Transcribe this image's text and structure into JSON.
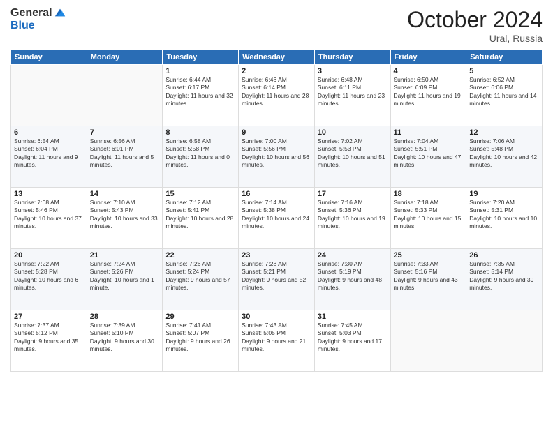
{
  "logo": {
    "general": "General",
    "blue": "Blue"
  },
  "title": "October 2024",
  "location": "Ural, Russia",
  "days_header": [
    "Sunday",
    "Monday",
    "Tuesday",
    "Wednesday",
    "Thursday",
    "Friday",
    "Saturday"
  ],
  "weeks": [
    [
      {
        "day": "",
        "info": ""
      },
      {
        "day": "",
        "info": ""
      },
      {
        "day": "1",
        "info": "Sunrise: 6:44 AM\nSunset: 6:17 PM\nDaylight: 11 hours and 32 minutes."
      },
      {
        "day": "2",
        "info": "Sunrise: 6:46 AM\nSunset: 6:14 PM\nDaylight: 11 hours and 28 minutes."
      },
      {
        "day": "3",
        "info": "Sunrise: 6:48 AM\nSunset: 6:11 PM\nDaylight: 11 hours and 23 minutes."
      },
      {
        "day": "4",
        "info": "Sunrise: 6:50 AM\nSunset: 6:09 PM\nDaylight: 11 hours and 19 minutes."
      },
      {
        "day": "5",
        "info": "Sunrise: 6:52 AM\nSunset: 6:06 PM\nDaylight: 11 hours and 14 minutes."
      }
    ],
    [
      {
        "day": "6",
        "info": "Sunrise: 6:54 AM\nSunset: 6:04 PM\nDaylight: 11 hours and 9 minutes."
      },
      {
        "day": "7",
        "info": "Sunrise: 6:56 AM\nSunset: 6:01 PM\nDaylight: 11 hours and 5 minutes."
      },
      {
        "day": "8",
        "info": "Sunrise: 6:58 AM\nSunset: 5:58 PM\nDaylight: 11 hours and 0 minutes."
      },
      {
        "day": "9",
        "info": "Sunrise: 7:00 AM\nSunset: 5:56 PM\nDaylight: 10 hours and 56 minutes."
      },
      {
        "day": "10",
        "info": "Sunrise: 7:02 AM\nSunset: 5:53 PM\nDaylight: 10 hours and 51 minutes."
      },
      {
        "day": "11",
        "info": "Sunrise: 7:04 AM\nSunset: 5:51 PM\nDaylight: 10 hours and 47 minutes."
      },
      {
        "day": "12",
        "info": "Sunrise: 7:06 AM\nSunset: 5:48 PM\nDaylight: 10 hours and 42 minutes."
      }
    ],
    [
      {
        "day": "13",
        "info": "Sunrise: 7:08 AM\nSunset: 5:46 PM\nDaylight: 10 hours and 37 minutes."
      },
      {
        "day": "14",
        "info": "Sunrise: 7:10 AM\nSunset: 5:43 PM\nDaylight: 10 hours and 33 minutes."
      },
      {
        "day": "15",
        "info": "Sunrise: 7:12 AM\nSunset: 5:41 PM\nDaylight: 10 hours and 28 minutes."
      },
      {
        "day": "16",
        "info": "Sunrise: 7:14 AM\nSunset: 5:38 PM\nDaylight: 10 hours and 24 minutes."
      },
      {
        "day": "17",
        "info": "Sunrise: 7:16 AM\nSunset: 5:36 PM\nDaylight: 10 hours and 19 minutes."
      },
      {
        "day": "18",
        "info": "Sunrise: 7:18 AM\nSunset: 5:33 PM\nDaylight: 10 hours and 15 minutes."
      },
      {
        "day": "19",
        "info": "Sunrise: 7:20 AM\nSunset: 5:31 PM\nDaylight: 10 hours and 10 minutes."
      }
    ],
    [
      {
        "day": "20",
        "info": "Sunrise: 7:22 AM\nSunset: 5:28 PM\nDaylight: 10 hours and 6 minutes."
      },
      {
        "day": "21",
        "info": "Sunrise: 7:24 AM\nSunset: 5:26 PM\nDaylight: 10 hours and 1 minute."
      },
      {
        "day": "22",
        "info": "Sunrise: 7:26 AM\nSunset: 5:24 PM\nDaylight: 9 hours and 57 minutes."
      },
      {
        "day": "23",
        "info": "Sunrise: 7:28 AM\nSunset: 5:21 PM\nDaylight: 9 hours and 52 minutes."
      },
      {
        "day": "24",
        "info": "Sunrise: 7:30 AM\nSunset: 5:19 PM\nDaylight: 9 hours and 48 minutes."
      },
      {
        "day": "25",
        "info": "Sunrise: 7:33 AM\nSunset: 5:16 PM\nDaylight: 9 hours and 43 minutes."
      },
      {
        "day": "26",
        "info": "Sunrise: 7:35 AM\nSunset: 5:14 PM\nDaylight: 9 hours and 39 minutes."
      }
    ],
    [
      {
        "day": "27",
        "info": "Sunrise: 7:37 AM\nSunset: 5:12 PM\nDaylight: 9 hours and 35 minutes."
      },
      {
        "day": "28",
        "info": "Sunrise: 7:39 AM\nSunset: 5:10 PM\nDaylight: 9 hours and 30 minutes."
      },
      {
        "day": "29",
        "info": "Sunrise: 7:41 AM\nSunset: 5:07 PM\nDaylight: 9 hours and 26 minutes."
      },
      {
        "day": "30",
        "info": "Sunrise: 7:43 AM\nSunset: 5:05 PM\nDaylight: 9 hours and 21 minutes."
      },
      {
        "day": "31",
        "info": "Sunrise: 7:45 AM\nSunset: 5:03 PM\nDaylight: 9 hours and 17 minutes."
      },
      {
        "day": "",
        "info": ""
      },
      {
        "day": "",
        "info": ""
      }
    ]
  ]
}
